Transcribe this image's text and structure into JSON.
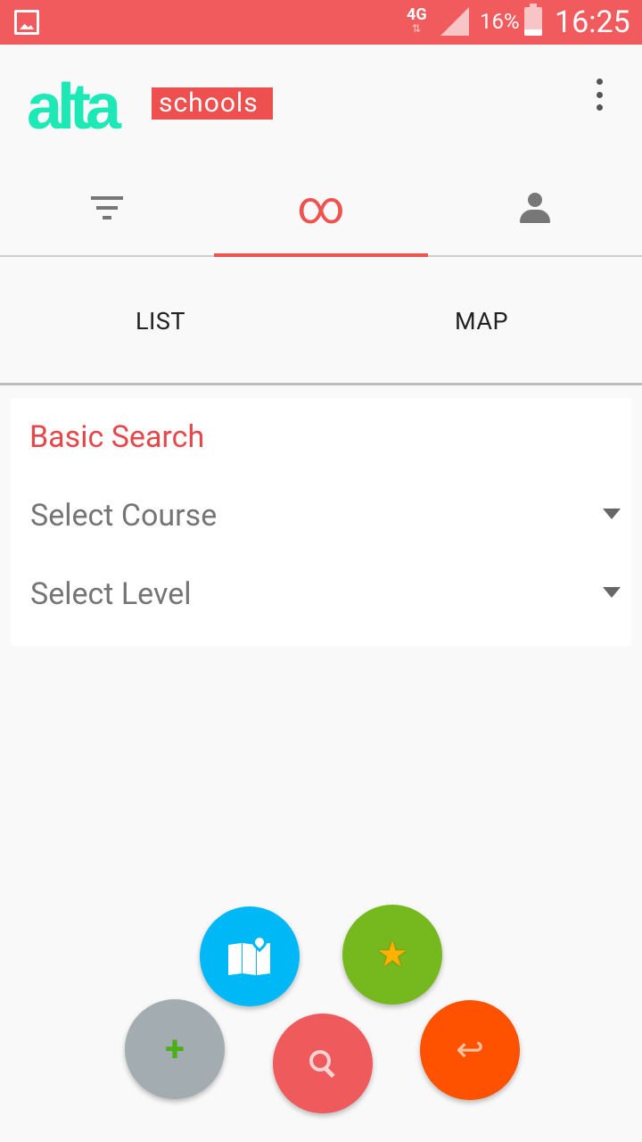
{
  "status_bar": {
    "network": "4G",
    "network_arrows": "⇅",
    "battery": "16%",
    "time": "16:25"
  },
  "app_bar": {
    "logo_alta": "alta",
    "logo_schools": "schools"
  },
  "tabs": [
    {
      "name": "filter",
      "icon": "filter-icon",
      "active": false
    },
    {
      "name": "infinity",
      "icon": "infinity-icon",
      "glyph": "∞",
      "active": true
    },
    {
      "name": "profile",
      "icon": "person-icon",
      "active": false
    }
  ],
  "subtabs": {
    "list_label": "LIST",
    "map_label": "MAP"
  },
  "search_card": {
    "title": "Basic Search",
    "course_select": "Select Course",
    "level_select": "Select Level"
  },
  "fab_icons": {
    "star": "★",
    "plus": "+",
    "back": "↩"
  },
  "colors": {
    "accent": "#ef5350",
    "status_bar": "#f15b5d",
    "logo_green": "#1de9b6",
    "fab_map": "#00b8f5",
    "fab_star": "#75b91e",
    "fab_add": "#a3acb0",
    "fab_search": "#ef5a5c",
    "fab_back": "#fe5200"
  }
}
